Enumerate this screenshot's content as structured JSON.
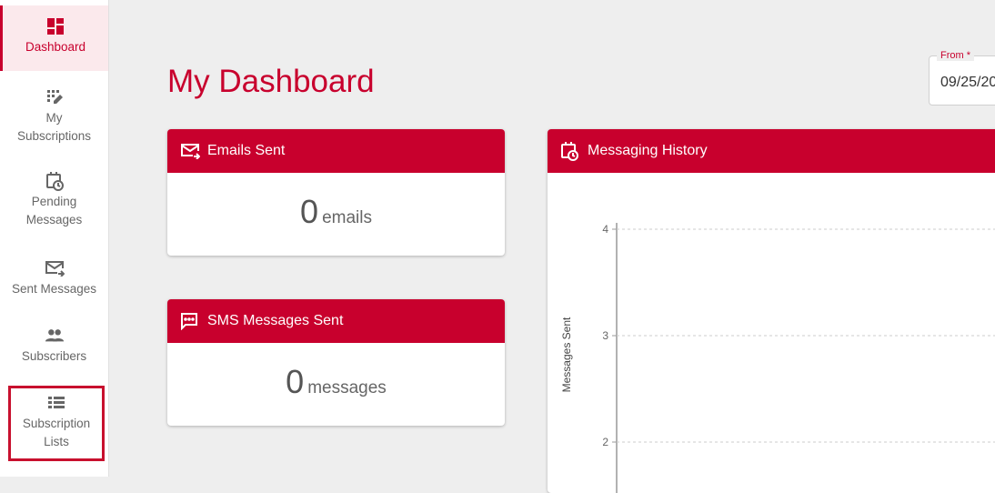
{
  "sidebar": {
    "items": [
      {
        "label": "Dashboard",
        "icon": "dashboard-icon"
      },
      {
        "label": "My\nSubscriptions",
        "icon": "edit-grid-icon"
      },
      {
        "label": "Pending\nMessages",
        "icon": "calendar-clock-icon"
      },
      {
        "label": "Sent Messages",
        "icon": "mail-forward-icon"
      },
      {
        "label": "Subscribers",
        "icon": "people-icon"
      },
      {
        "label": "Subscription\nLists",
        "icon": "list-icon"
      }
    ]
  },
  "header": {
    "title": "My Dashboard",
    "from_label": "From *",
    "from_value": "09/25/20"
  },
  "cards": {
    "emails": {
      "title": "Emails Sent",
      "count": "0",
      "unit": "emails"
    },
    "sms": {
      "title": "SMS Messages Sent",
      "count": "0",
      "unit": "messages"
    },
    "history": {
      "title": "Messaging History"
    }
  },
  "colors": {
    "accent": "#c8002d",
    "background": "#eeeeee"
  },
  "chart_data": {
    "type": "line",
    "title": "",
    "ylabel": "Messages Sent",
    "yticks": [
      4,
      3,
      2
    ],
    "series": []
  }
}
